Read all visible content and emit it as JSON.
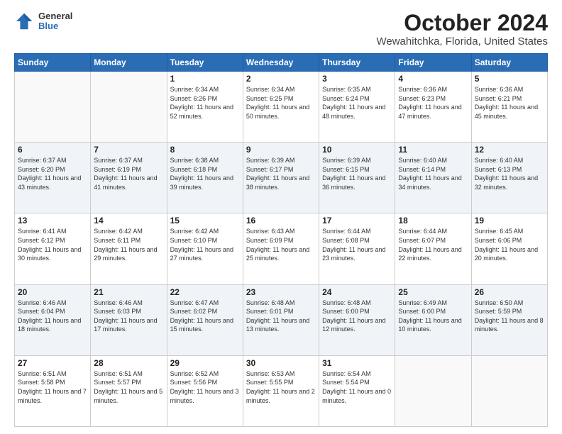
{
  "header": {
    "logo": {
      "general": "General",
      "blue": "Blue"
    },
    "title": "October 2024",
    "location": "Wewahitchka, Florida, United States"
  },
  "weekdays": [
    "Sunday",
    "Monday",
    "Tuesday",
    "Wednesday",
    "Thursday",
    "Friday",
    "Saturday"
  ],
  "weeks": [
    [
      {
        "day": "",
        "sunrise": "",
        "sunset": "",
        "daylight": ""
      },
      {
        "day": "",
        "sunrise": "",
        "sunset": "",
        "daylight": ""
      },
      {
        "day": "1",
        "sunrise": "Sunrise: 6:34 AM",
        "sunset": "Sunset: 6:26 PM",
        "daylight": "Daylight: 11 hours and 52 minutes."
      },
      {
        "day": "2",
        "sunrise": "Sunrise: 6:34 AM",
        "sunset": "Sunset: 6:25 PM",
        "daylight": "Daylight: 11 hours and 50 minutes."
      },
      {
        "day": "3",
        "sunrise": "Sunrise: 6:35 AM",
        "sunset": "Sunset: 6:24 PM",
        "daylight": "Daylight: 11 hours and 48 minutes."
      },
      {
        "day": "4",
        "sunrise": "Sunrise: 6:36 AM",
        "sunset": "Sunset: 6:23 PM",
        "daylight": "Daylight: 11 hours and 47 minutes."
      },
      {
        "day": "5",
        "sunrise": "Sunrise: 6:36 AM",
        "sunset": "Sunset: 6:21 PM",
        "daylight": "Daylight: 11 hours and 45 minutes."
      }
    ],
    [
      {
        "day": "6",
        "sunrise": "Sunrise: 6:37 AM",
        "sunset": "Sunset: 6:20 PM",
        "daylight": "Daylight: 11 hours and 43 minutes."
      },
      {
        "day": "7",
        "sunrise": "Sunrise: 6:37 AM",
        "sunset": "Sunset: 6:19 PM",
        "daylight": "Daylight: 11 hours and 41 minutes."
      },
      {
        "day": "8",
        "sunrise": "Sunrise: 6:38 AM",
        "sunset": "Sunset: 6:18 PM",
        "daylight": "Daylight: 11 hours and 39 minutes."
      },
      {
        "day": "9",
        "sunrise": "Sunrise: 6:39 AM",
        "sunset": "Sunset: 6:17 PM",
        "daylight": "Daylight: 11 hours and 38 minutes."
      },
      {
        "day": "10",
        "sunrise": "Sunrise: 6:39 AM",
        "sunset": "Sunset: 6:15 PM",
        "daylight": "Daylight: 11 hours and 36 minutes."
      },
      {
        "day": "11",
        "sunrise": "Sunrise: 6:40 AM",
        "sunset": "Sunset: 6:14 PM",
        "daylight": "Daylight: 11 hours and 34 minutes."
      },
      {
        "day": "12",
        "sunrise": "Sunrise: 6:40 AM",
        "sunset": "Sunset: 6:13 PM",
        "daylight": "Daylight: 11 hours and 32 minutes."
      }
    ],
    [
      {
        "day": "13",
        "sunrise": "Sunrise: 6:41 AM",
        "sunset": "Sunset: 6:12 PM",
        "daylight": "Daylight: 11 hours and 30 minutes."
      },
      {
        "day": "14",
        "sunrise": "Sunrise: 6:42 AM",
        "sunset": "Sunset: 6:11 PM",
        "daylight": "Daylight: 11 hours and 29 minutes."
      },
      {
        "day": "15",
        "sunrise": "Sunrise: 6:42 AM",
        "sunset": "Sunset: 6:10 PM",
        "daylight": "Daylight: 11 hours and 27 minutes."
      },
      {
        "day": "16",
        "sunrise": "Sunrise: 6:43 AM",
        "sunset": "Sunset: 6:09 PM",
        "daylight": "Daylight: 11 hours and 25 minutes."
      },
      {
        "day": "17",
        "sunrise": "Sunrise: 6:44 AM",
        "sunset": "Sunset: 6:08 PM",
        "daylight": "Daylight: 11 hours and 23 minutes."
      },
      {
        "day": "18",
        "sunrise": "Sunrise: 6:44 AM",
        "sunset": "Sunset: 6:07 PM",
        "daylight": "Daylight: 11 hours and 22 minutes."
      },
      {
        "day": "19",
        "sunrise": "Sunrise: 6:45 AM",
        "sunset": "Sunset: 6:06 PM",
        "daylight": "Daylight: 11 hours and 20 minutes."
      }
    ],
    [
      {
        "day": "20",
        "sunrise": "Sunrise: 6:46 AM",
        "sunset": "Sunset: 6:04 PM",
        "daylight": "Daylight: 11 hours and 18 minutes."
      },
      {
        "day": "21",
        "sunrise": "Sunrise: 6:46 AM",
        "sunset": "Sunset: 6:03 PM",
        "daylight": "Daylight: 11 hours and 17 minutes."
      },
      {
        "day": "22",
        "sunrise": "Sunrise: 6:47 AM",
        "sunset": "Sunset: 6:02 PM",
        "daylight": "Daylight: 11 hours and 15 minutes."
      },
      {
        "day": "23",
        "sunrise": "Sunrise: 6:48 AM",
        "sunset": "Sunset: 6:01 PM",
        "daylight": "Daylight: 11 hours and 13 minutes."
      },
      {
        "day": "24",
        "sunrise": "Sunrise: 6:48 AM",
        "sunset": "Sunset: 6:00 PM",
        "daylight": "Daylight: 11 hours and 12 minutes."
      },
      {
        "day": "25",
        "sunrise": "Sunrise: 6:49 AM",
        "sunset": "Sunset: 6:00 PM",
        "daylight": "Daylight: 11 hours and 10 minutes."
      },
      {
        "day": "26",
        "sunrise": "Sunrise: 6:50 AM",
        "sunset": "Sunset: 5:59 PM",
        "daylight": "Daylight: 11 hours and 8 minutes."
      }
    ],
    [
      {
        "day": "27",
        "sunrise": "Sunrise: 6:51 AM",
        "sunset": "Sunset: 5:58 PM",
        "daylight": "Daylight: 11 hours and 7 minutes."
      },
      {
        "day": "28",
        "sunrise": "Sunrise: 6:51 AM",
        "sunset": "Sunset: 5:57 PM",
        "daylight": "Daylight: 11 hours and 5 minutes."
      },
      {
        "day": "29",
        "sunrise": "Sunrise: 6:52 AM",
        "sunset": "Sunset: 5:56 PM",
        "daylight": "Daylight: 11 hours and 3 minutes."
      },
      {
        "day": "30",
        "sunrise": "Sunrise: 6:53 AM",
        "sunset": "Sunset: 5:55 PM",
        "daylight": "Daylight: 11 hours and 2 minutes."
      },
      {
        "day": "31",
        "sunrise": "Sunrise: 6:54 AM",
        "sunset": "Sunset: 5:54 PM",
        "daylight": "Daylight: 11 hours and 0 minutes."
      },
      {
        "day": "",
        "sunrise": "",
        "sunset": "",
        "daylight": ""
      },
      {
        "day": "",
        "sunrise": "",
        "sunset": "",
        "daylight": ""
      }
    ]
  ]
}
